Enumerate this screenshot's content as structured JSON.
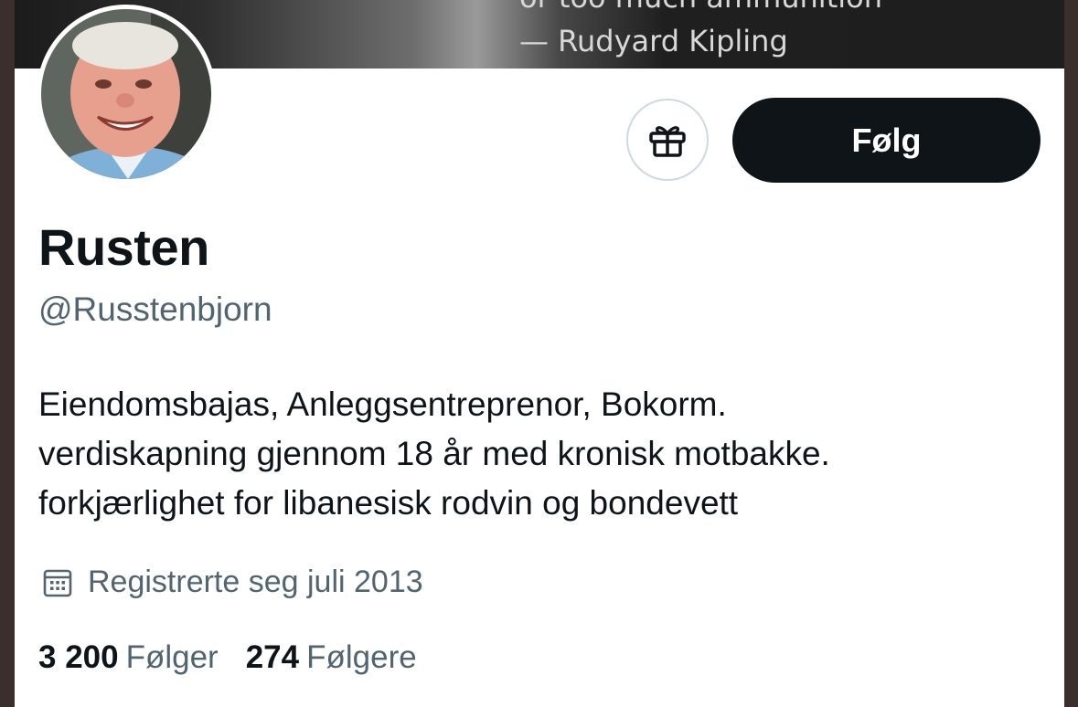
{
  "banner": {
    "quote_line1": "or too much ammunition",
    "quote_line2": "— Rudyard Kipling"
  },
  "profile": {
    "name": "Rusten",
    "handle": "@Russtenbjorn",
    "bio": [
      "Eiendomsbajas, Anleggsentreprenor, Bokorm.",
      "verdiskapning gjennom 18 år med kronisk motbakke.",
      "forkjærlighet for libanesisk rodvin og bondevett"
    ],
    "joined": "Registrerte seg juli 2013",
    "following_count": "3 200",
    "following_label": "Følger",
    "followers_count": "274",
    "followers_label": "Følgere"
  },
  "actions": {
    "follow_label": "Følg",
    "gift_icon": "gift-icon"
  },
  "colors": {
    "primary_text": "#0f1419",
    "secondary_text": "#536471",
    "follow_bg": "#0f1419",
    "border": "#cfd9de"
  }
}
